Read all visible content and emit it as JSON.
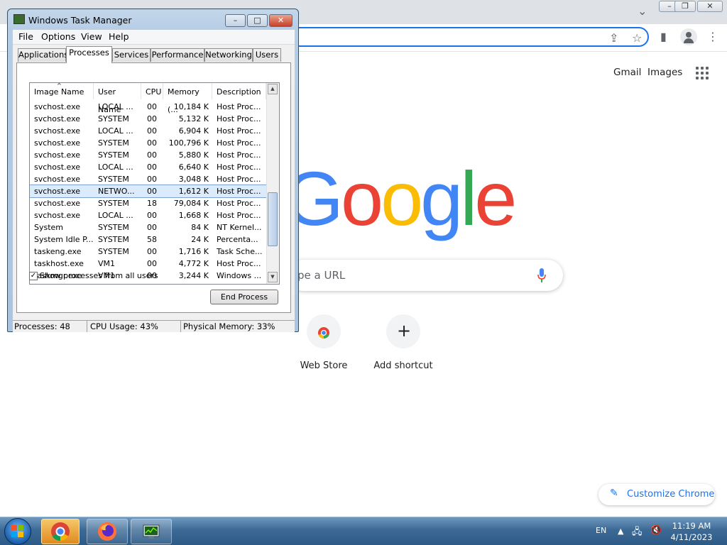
{
  "chrome": {
    "gmail_label": "Gmail",
    "images_label": "Images",
    "logo_letters": [
      {
        "ch": "G",
        "color": "#4285f4"
      },
      {
        "ch": "o",
        "color": "#ea4335"
      },
      {
        "ch": "o",
        "color": "#fbbc05"
      },
      {
        "ch": "g",
        "color": "#4285f4"
      },
      {
        "ch": "l",
        "color": "#34a853"
      },
      {
        "ch": "e",
        "color": "#ea4335"
      }
    ],
    "search_placeholder": "pe a URL",
    "shortcuts": [
      {
        "label": "Web Store",
        "icon": "chrome-web-store-icon"
      },
      {
        "label": "Add shortcut",
        "icon": "plus-icon"
      }
    ],
    "customize_label": "Customize Chrome",
    "window_buttons": [
      "–",
      "❐",
      "✕"
    ]
  },
  "task_manager": {
    "title": "Windows Task Manager",
    "menus": [
      "File",
      "Options",
      "View",
      "Help"
    ],
    "tabs": [
      "Applications",
      "Processes",
      "Services",
      "Performance",
      "Networking",
      "Users"
    ],
    "active_tab": "Processes",
    "columns": [
      "Image Name",
      "User Name",
      "CPU",
      "Memory (...",
      "Description"
    ],
    "rows": [
      [
        "svchost.exe",
        "LOCAL ...",
        "00",
        "10,184 K",
        "Host Proc..."
      ],
      [
        "svchost.exe",
        "SYSTEM",
        "00",
        "5,132 K",
        "Host Proc..."
      ],
      [
        "svchost.exe",
        "LOCAL ...",
        "00",
        "6,904 K",
        "Host Proc..."
      ],
      [
        "svchost.exe",
        "SYSTEM",
        "00",
        "100,796 K",
        "Host Proc..."
      ],
      [
        "svchost.exe",
        "SYSTEM",
        "00",
        "5,880 K",
        "Host Proc..."
      ],
      [
        "svchost.exe",
        "LOCAL ...",
        "00",
        "6,640 K",
        "Host Proc..."
      ],
      [
        "svchost.exe",
        "SYSTEM",
        "00",
        "3,048 K",
        "Host Proc..."
      ],
      [
        "svchost.exe",
        "NETWO...",
        "00",
        "1,612 K",
        "Host Proc..."
      ],
      [
        "svchost.exe",
        "SYSTEM",
        "18",
        "79,084 K",
        "Host Proc..."
      ],
      [
        "svchost.exe",
        "LOCAL ...",
        "00",
        "1,668 K",
        "Host Proc..."
      ],
      [
        "System",
        "SYSTEM",
        "00",
        "84 K",
        "NT Kernel..."
      ],
      [
        "System Idle P...",
        "SYSTEM",
        "58",
        "24 K",
        "Percenta..."
      ],
      [
        "taskeng.exe",
        "SYSTEM",
        "00",
        "1,716 K",
        "Task Sche..."
      ],
      [
        "taskhost.exe",
        "VM1",
        "00",
        "4,772 K",
        "Host Proc..."
      ],
      [
        "taskmgr.exe",
        "VM1",
        "00",
        "3,244 K",
        "Windows ..."
      ]
    ],
    "selected_row": 7,
    "show_all_label": "Show processes from all users",
    "show_all_checked": true,
    "end_process_label": "End Process",
    "status": {
      "processes": "Processes: 48",
      "cpu": "CPU Usage: 43%",
      "memory": "Physical Memory: 33%"
    },
    "caption_buttons": [
      "–",
      "□",
      "✕"
    ]
  },
  "taskbar": {
    "apps": [
      {
        "name": "chrome-icon",
        "active": true
      },
      {
        "name": "firefox-icon",
        "active": false
      },
      {
        "name": "task-manager-icon",
        "active": false
      }
    ],
    "language": "EN",
    "time": "11:19 AM",
    "date": "4/11/2023"
  }
}
